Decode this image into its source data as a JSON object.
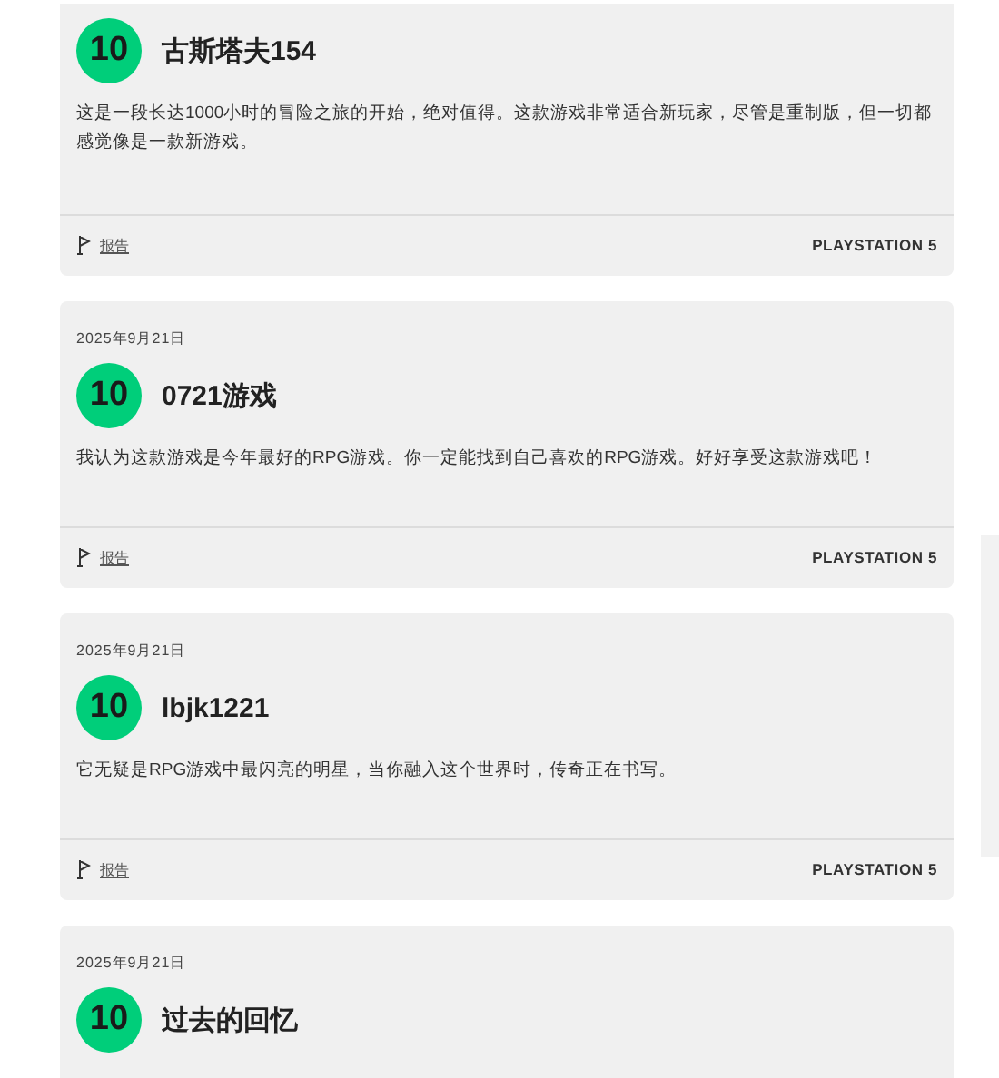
{
  "reviews": [
    {
      "score": "10",
      "author": "古斯塔夫154",
      "text": "这是一段长达1000小时的冒险之旅的开始，绝对值得。这款游戏非常适合新玩家，尽管是重制版，但一切都感觉像是一款新游戏。",
      "report": "报告",
      "platform": "PLAYSTATION 5"
    },
    {
      "date": "2025年9月21日",
      "score": "10",
      "author": "0721游戏",
      "text": "我认为这款游戏是今年最好的RPG游戏。你一定能找到自己喜欢的RPG游戏。好好享受这款游戏吧！",
      "report": "报告",
      "platform": "PLAYSTATION 5"
    },
    {
      "date": "2025年9月21日",
      "score": "10",
      "author": "lbjk1221",
      "text": "它无疑是RPG游戏中最闪亮的明星，当你融入这个世界时，传奇正在书写。",
      "report": "报告",
      "platform": "PLAYSTATION 5"
    },
    {
      "date": "2025年9月21日",
      "score": "10",
      "author": "过去的回忆"
    }
  ]
}
